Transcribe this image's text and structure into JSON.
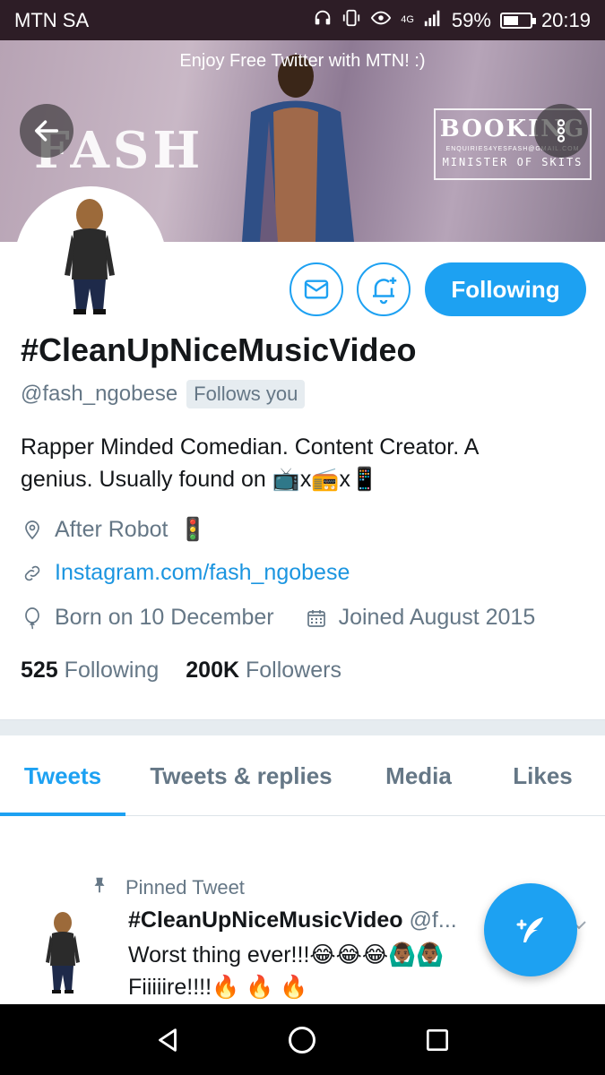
{
  "status_bar": {
    "carrier": "MTN SA",
    "network": "4G",
    "battery": "59%",
    "battery_level": 0.59,
    "time": "20:19"
  },
  "banner": {
    "promo": "Enjoy Free Twitter with MTN! :)",
    "fash_text": "FASH",
    "booking_title": "BOOKING",
    "booking_email": "ENQUIRIES4YESFASH@GMAIL.COM",
    "booking_subtitle": "MINISTER OF SKITS"
  },
  "profile": {
    "name": "#CleanUpNiceMusicVideo",
    "handle": "@fash_ngobese",
    "follows_you": "Follows you",
    "bio_line1": "Rapper Minded Comedian. Content Creator. A",
    "bio_line2_text": "genius. Usually found on ",
    "bio_emoji_tv": "📺",
    "bio_x1": "x",
    "bio_emoji_radio": "📻",
    "bio_x2": "x",
    "bio_emoji_phone": "📱",
    "location": "After Robot",
    "location_emoji": "🚦",
    "website": "Instagram.com/fash_ngobese",
    "birthday": "Born on 10 December",
    "joined": "Joined August 2015"
  },
  "actions": {
    "following_label": "Following"
  },
  "counts": {
    "following_num": "525",
    "following_label": "Following",
    "followers_num": "200K",
    "followers_label": "Followers"
  },
  "tabs": [
    "Tweets",
    "Tweets & replies",
    "Media",
    "Likes"
  ],
  "tweet": {
    "pinned_label": "Pinned Tweet",
    "author": "#CleanUpNiceMusicVideo",
    "handle": "@f...",
    "text_line1": "Worst thing ever!!!😂😂😂🙆🏾‍♂️🙆🏾‍♂️",
    "text_line2": "Fiiiiire!!!!🔥 🔥 🔥"
  },
  "colors": {
    "accent": "#1da1f2",
    "link": "#1b95e0",
    "secondary_text": "#657786",
    "status_bar": "#2d1d26"
  },
  "icons": {
    "back": "arrow-left-icon",
    "more": "more-vertical-icon",
    "mail": "envelope-icon",
    "bell": "bell-plus-icon",
    "location": "map-pin-icon",
    "link": "link-icon",
    "birthday": "balloon-icon",
    "calendar": "calendar-icon",
    "pin": "pin-icon",
    "compose": "compose-quill-icon"
  }
}
